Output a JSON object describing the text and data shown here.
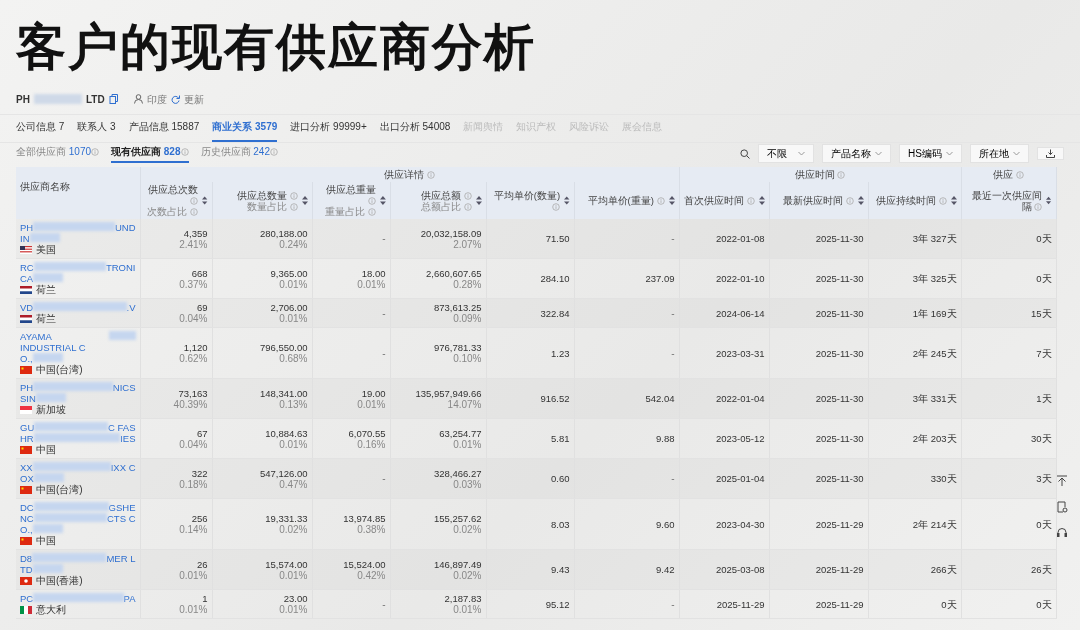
{
  "title": "客户的现有供应商分析",
  "company": {
    "name_start": "PH",
    "name_end": "LTD",
    "country": "印度",
    "refresh": "更新"
  },
  "tabs": [
    {
      "label": "公司信息",
      "count": "7",
      "selected": false,
      "disabled": false
    },
    {
      "label": "联系人",
      "count": "3",
      "selected": false,
      "disabled": false
    },
    {
      "label": "产品信息",
      "count": "15887",
      "selected": false,
      "disabled": false
    },
    {
      "label": "商业关系",
      "count": "3579",
      "selected": true,
      "disabled": false
    },
    {
      "label": "进口分析",
      "count": "99999+",
      "selected": false,
      "disabled": false
    },
    {
      "label": "出口分析",
      "count": "54008",
      "selected": false,
      "disabled": false
    },
    {
      "label": "新闻舆情",
      "selected": false,
      "disabled": true
    },
    {
      "label": "知识产权",
      "selected": false,
      "disabled": true
    },
    {
      "label": "风险诉讼",
      "selected": false,
      "disabled": true
    },
    {
      "label": "展会信息",
      "selected": false,
      "disabled": true
    }
  ],
  "subtabs": [
    {
      "label": "全部供应商",
      "count": "1070",
      "selected": false
    },
    {
      "label": "现有供应商",
      "count": "828",
      "selected": true
    },
    {
      "label": "历史供应商",
      "count": "242",
      "selected": false
    }
  ],
  "filters": [
    "不限",
    "产品名称",
    "HS编码",
    "所在地"
  ],
  "table": {
    "name_header": "供应商名称",
    "groups": [
      {
        "label": "供应详情"
      },
      {
        "label": "供应时间"
      },
      {
        "label": "供应"
      }
    ],
    "columns": [
      {
        "label": "供应总次数",
        "sub": "次数占比"
      },
      {
        "label": "供应总数量",
        "sub": "数量占比"
      },
      {
        "label": "供应总重量",
        "sub": "重量占比"
      },
      {
        "label": "供应总额",
        "sub": "总额占比"
      },
      {
        "label": "平均单价(数量)"
      },
      {
        "label": "平均单价(重量)"
      },
      {
        "label": "首次供应时间"
      },
      {
        "label": "最新供应时间"
      },
      {
        "label": "供应持续时间"
      },
      {
        "label": "最近一次供应间隔"
      }
    ],
    "rows": [
      {
        "name_lines": [
          [
            "PH",
            "UND"
          ],
          [
            "IN"
          ]
        ],
        "kind": "us",
        "country": "美国",
        "values": [
          [
            "4,359",
            "2.41%"
          ],
          [
            "280,188.00",
            "0.24%"
          ],
          [
            "-"
          ],
          [
            "20,032,158.09",
            "2.07%"
          ],
          [
            "71.50"
          ],
          [
            "-"
          ],
          [
            "2022-01-08"
          ],
          [
            "2025-11-30"
          ],
          [
            "3年 327天"
          ],
          [
            "0天"
          ]
        ]
      },
      {
        "name_lines": [
          [
            "RC",
            "TRONI"
          ],
          [
            "CA"
          ]
        ],
        "kind": "nl",
        "country": "荷兰",
        "values": [
          [
            "668",
            "0.37%"
          ],
          [
            "9,365.00",
            "0.01%"
          ],
          [
            "18.00",
            "0.01%"
          ],
          [
            "2,660,607.65",
            "0.28%"
          ],
          [
            "284.10"
          ],
          [
            "237.09"
          ],
          [
            "2022-01-10"
          ],
          [
            "2025-11-30"
          ],
          [
            "3年 325天"
          ],
          [
            "0天"
          ]
        ]
      },
      {
        "name_lines": [
          [
            "VD",
            ".V"
          ]
        ],
        "kind": "nl",
        "country": "荷兰",
        "values": [
          [
            "69",
            "0.04%"
          ],
          [
            "2,706.00",
            "0.01%"
          ],
          [
            "-"
          ],
          [
            "873,613.25",
            "0.09%"
          ],
          [
            "322.84"
          ],
          [
            "-"
          ],
          [
            "2024-06-14"
          ],
          [
            "2025-11-30"
          ],
          [
            "1年 169天"
          ],
          [
            "15天"
          ]
        ]
      },
      {
        "name_lines": [
          [
            "AYAMA INDUSTRIAL C"
          ],
          [
            "O.,"
          ]
        ],
        "kind": "cn",
        "country": "中国(台湾)",
        "values": [
          [
            "1,120",
            "0.62%"
          ],
          [
            "796,550.00",
            "0.68%"
          ],
          [
            "-"
          ],
          [
            "976,781.33",
            "0.10%"
          ],
          [
            "1.23"
          ],
          [
            "-"
          ],
          [
            "2023-03-31"
          ],
          [
            "2025-11-30"
          ],
          [
            "2年 245天"
          ],
          [
            "7天"
          ]
        ]
      },
      {
        "name_lines": [
          [
            "PH",
            "NICS"
          ],
          [
            "SIN"
          ]
        ],
        "kind": "sg",
        "country": "新加坡",
        "values": [
          [
            "73,163",
            "40.39%"
          ],
          [
            "148,341.00",
            "0.13%"
          ],
          [
            "19.00",
            "0.01%"
          ],
          [
            "135,957,949.66",
            "14.07%"
          ],
          [
            "916.52"
          ],
          [
            "542.04"
          ],
          [
            "2022-01-04"
          ],
          [
            "2025-11-30"
          ],
          [
            "3年 331天"
          ],
          [
            "1天"
          ]
        ]
      },
      {
        "name_lines": [
          [
            "GU",
            "C FAS"
          ],
          [
            "HR",
            "IES"
          ]
        ],
        "kind": "cn",
        "country": "中国",
        "values": [
          [
            "67",
            "0.04%"
          ],
          [
            "10,884.63",
            "0.01%"
          ],
          [
            "6,070.55",
            "0.16%"
          ],
          [
            "63,254.77",
            "0.01%"
          ],
          [
            "5.81"
          ],
          [
            "9.88"
          ],
          [
            "2023-05-12"
          ],
          [
            "2025-11-30"
          ],
          [
            "2年 203天"
          ],
          [
            "30天"
          ]
        ]
      },
      {
        "name_lines": [
          [
            "XX",
            "IXX C"
          ],
          [
            "OX"
          ]
        ],
        "kind": "cn",
        "country": "中国(台湾)",
        "values": [
          [
            "322",
            "0.18%"
          ],
          [
            "547,126.00",
            "0.47%"
          ],
          [
            "-"
          ],
          [
            "328,466.27",
            "0.03%"
          ],
          [
            "0.60"
          ],
          [
            "-"
          ],
          [
            "2025-01-04"
          ],
          [
            "2025-11-30"
          ],
          [
            "330天"
          ],
          [
            "3天"
          ]
        ]
      },
      {
        "name_lines": [
          [
            "DC",
            "GSHE"
          ],
          [
            "NC",
            "CTS C"
          ],
          [
            "O.,"
          ]
        ],
        "kind": "cn",
        "country": "中国",
        "values": [
          [
            "256",
            "0.14%"
          ],
          [
            "19,331.33",
            "0.02%"
          ],
          [
            "13,974.85",
            "0.38%"
          ],
          [
            "155,257.62",
            "0.02%"
          ],
          [
            "8.03"
          ],
          [
            "9.60"
          ],
          [
            "2023-04-30"
          ],
          [
            "2025-11-29"
          ],
          [
            "2年 214天"
          ],
          [
            "0天"
          ]
        ]
      },
      {
        "name_lines": [
          [
            "D8",
            "MER L"
          ],
          [
            "TD"
          ]
        ],
        "kind": "hk",
        "country": "中国(香港)",
        "values": [
          [
            "26",
            "0.01%"
          ],
          [
            "15,574.00",
            "0.01%"
          ],
          [
            "15,524.00",
            "0.42%"
          ],
          [
            "146,897.49",
            "0.02%"
          ],
          [
            "9.43"
          ],
          [
            "9.42"
          ],
          [
            "2025-03-08"
          ],
          [
            "2025-11-29"
          ],
          [
            "266天"
          ],
          [
            "26天"
          ]
        ]
      },
      {
        "name_lines": [
          [
            "PC",
            "PA"
          ]
        ],
        "kind": "it",
        "country": "意大利",
        "values": [
          [
            "1",
            "0.01%"
          ],
          [
            "23.00",
            "0.01%"
          ],
          [
            "-"
          ],
          [
            "2,187.83",
            "0.01%"
          ],
          [
            "95.12"
          ],
          [
            "-"
          ],
          [
            "2025-11-29"
          ],
          [
            "2025-11-29"
          ],
          [
            "0天"
          ],
          [
            "0天"
          ]
        ]
      }
    ]
  }
}
